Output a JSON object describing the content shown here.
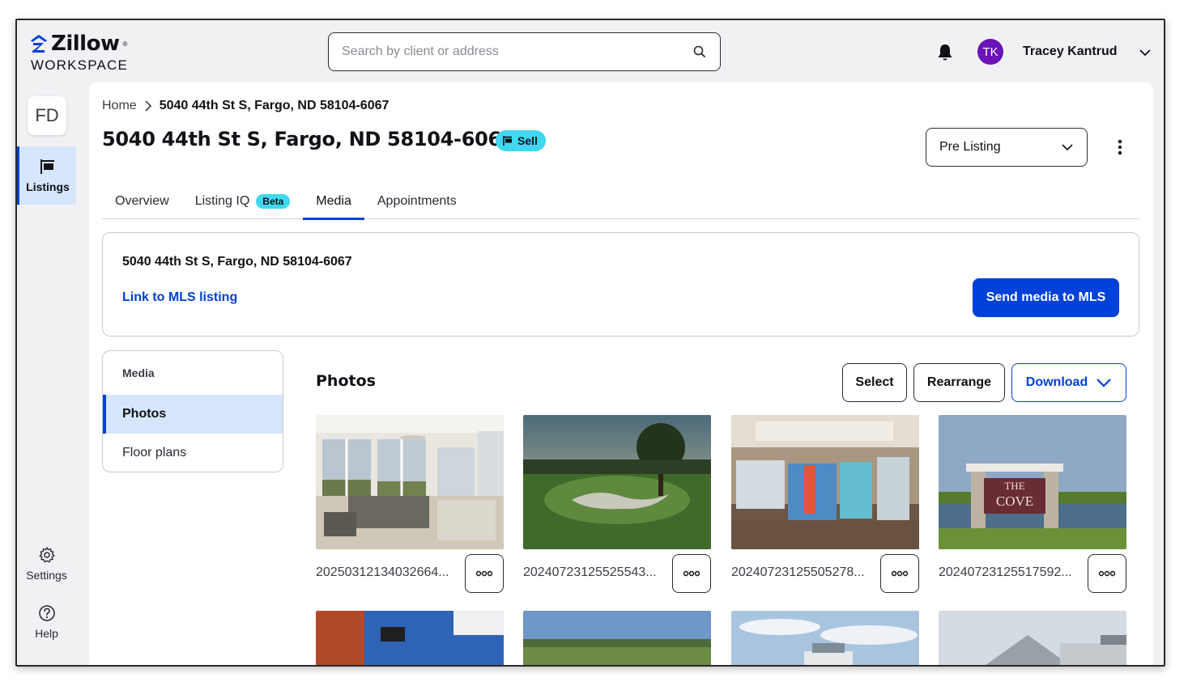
{
  "brand": {
    "name": "Zillow",
    "sub": "WORKSPACE",
    "accent": "#0041d9"
  },
  "search": {
    "placeholder": "Search by client or address",
    "value": ""
  },
  "user": {
    "initials": "TK",
    "name": "Tracey Kantrud",
    "avatar_color": "#6b12b8"
  },
  "sidebar": {
    "workspace_initials": "FD",
    "items": [
      {
        "label": "Listings",
        "icon": "sign-icon",
        "active": true
      },
      {
        "label": "Settings",
        "icon": "gear-icon"
      },
      {
        "label": "Help",
        "icon": "help-icon"
      }
    ]
  },
  "breadcrumb": {
    "home": "Home",
    "current": "5040 44th St S, Fargo, ND 58104-6067"
  },
  "listing": {
    "title": "5040 44th St S, Fargo, ND 58104-6067",
    "badge": "Sell",
    "status": "Pre Listing"
  },
  "tabs": [
    {
      "label": "Overview"
    },
    {
      "label": "Listing IQ",
      "badge": "Beta"
    },
    {
      "label": "Media",
      "active": true
    },
    {
      "label": "Appointments"
    }
  ],
  "mls": {
    "address": "5040 44th St S, Fargo, ND 58104-6067",
    "link_label": "Link to MLS listing",
    "send_label": "Send media to MLS"
  },
  "media_nav": {
    "header": "Media",
    "items": [
      {
        "label": "Photos",
        "active": true
      },
      {
        "label": "Floor plans"
      }
    ]
  },
  "photos": {
    "title": "Photos",
    "select_label": "Select",
    "rearrange_label": "Rearrange",
    "download_label": "Download",
    "items": [
      {
        "filename": "20250312134032664..."
      },
      {
        "filename": "20240723125525543..."
      },
      {
        "filename": "20240723125505278..."
      },
      {
        "filename": "20240723125517592...",
        "sign_line1": "THE",
        "sign_line2": "COVE"
      }
    ]
  }
}
